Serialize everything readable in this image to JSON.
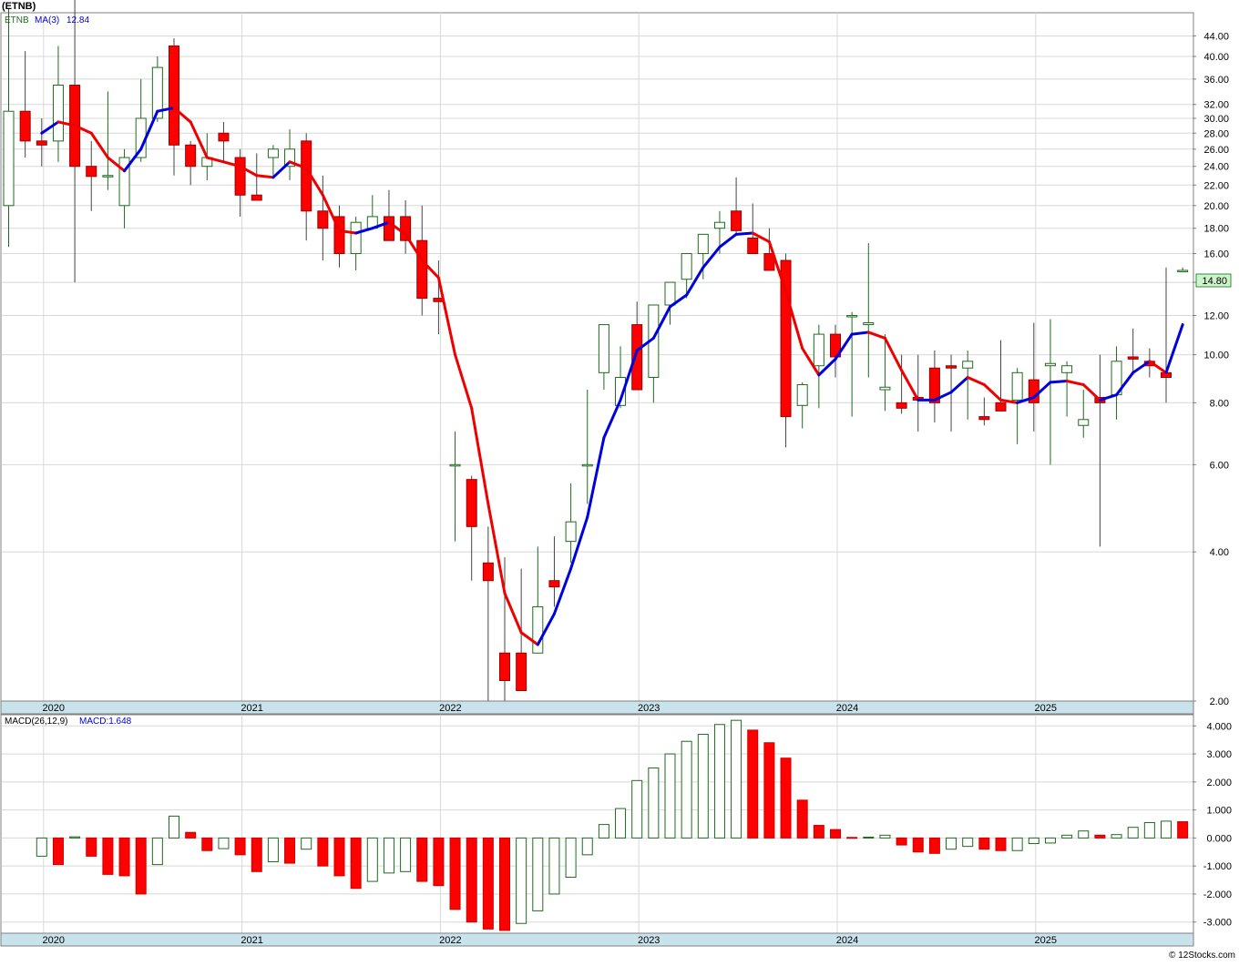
{
  "header": {
    "ticker_label": "(ETNB)"
  },
  "price_panel": {
    "legend_symbol": "ETNB",
    "ma_label": "MA(3)",
    "ma_value": "12.84",
    "last_price_label": "14.80",
    "y_ticks": [
      "2.00",
      "4.00",
      "6.00",
      "8.00",
      "10.00",
      "12.00",
      "14.00",
      "16.00",
      "18.00",
      "20.00",
      "22.00",
      "24.00",
      "26.00",
      "28.00",
      "30.00",
      "32.00",
      "36.00",
      "40.00",
      "44.00"
    ]
  },
  "macd_panel": {
    "legend_params": "MACD(26,12,9)",
    "legend_value": "MACD:1.648",
    "y_ticks": [
      "4.000",
      "3.000",
      "2.000",
      "1.000",
      "0.000",
      "-1.000",
      "-2.000",
      "-3.000"
    ]
  },
  "x_axis": {
    "year_labels": [
      "2020",
      "2021",
      "2022",
      "2023",
      "2024",
      "2025"
    ]
  },
  "footer": {
    "watermark": "© 12Stocks.com"
  },
  "colors": {
    "up": "#1e6b1e",
    "down": "#ff0000",
    "ma_up": "#0000dd",
    "ma_down": "#ee0000",
    "grid": "#d8d8d8",
    "axis_band": "#c9e3ec",
    "price_tag_bg": "#ccf5cc"
  },
  "chart_data": [
    {
      "type": "candlestick",
      "interval": "monthly",
      "scale": "log",
      "ylim": [
        2.0,
        49.0
      ],
      "months": [
        "2019-11",
        "2019-12",
        "2020-01",
        "2020-02",
        "2020-03",
        "2020-04",
        "2020-05",
        "2020-06",
        "2020-07",
        "2020-08",
        "2020-09",
        "2020-10",
        "2020-11",
        "2020-12",
        "2021-01",
        "2021-02",
        "2021-03",
        "2021-04",
        "2021-05",
        "2021-06",
        "2021-07",
        "2021-08",
        "2021-09",
        "2021-10",
        "2021-11",
        "2021-12",
        "2022-01",
        "2022-02",
        "2022-03",
        "2022-04",
        "2022-05",
        "2022-06",
        "2022-07",
        "2022-08",
        "2022-09",
        "2022-10",
        "2022-11",
        "2022-12",
        "2023-01",
        "2023-02",
        "2023-03",
        "2023-04",
        "2023-05",
        "2023-06",
        "2023-07",
        "2023-08",
        "2023-09",
        "2023-10",
        "2023-11",
        "2023-12",
        "2024-01",
        "2024-02",
        "2024-03",
        "2024-04",
        "2024-05",
        "2024-06",
        "2024-07",
        "2024-08",
        "2024-09",
        "2024-10",
        "2024-11",
        "2024-12",
        "2025-01",
        "2025-02",
        "2025-03",
        "2025-04",
        "2025-05",
        "2025-06",
        "2025-07",
        "2025-08",
        "2025-09",
        "2025-10"
      ],
      "open": [
        20.0,
        31.0,
        27.0,
        27.0,
        35.0,
        24.0,
        22.9,
        20.0,
        25.0,
        30.0,
        42.0,
        26.5,
        24.0,
        28.0,
        25.0,
        21.0,
        25.0,
        24.0,
        27.0,
        19.5,
        19.0,
        16.0,
        18.0,
        19.0,
        19.0,
        17.0,
        13.0,
        6.0,
        5.6,
        3.8,
        2.5,
        2.5,
        2.5,
        3.5,
        4.2,
        6.0,
        9.2,
        7.9,
        11.5,
        9.0,
        12.6,
        14.2,
        16.0,
        18.0,
        19.5,
        17.2,
        16.0,
        15.5,
        7.9,
        9.5,
        11.0,
        12.0,
        11.5,
        8.5,
        8.0,
        8.2,
        9.4,
        9.5,
        9.4,
        7.5,
        8.0,
        8.1,
        8.9,
        9.5,
        9.2,
        7.2,
        8.2,
        8.3,
        9.9,
        9.7,
        9.2,
        14.8
      ],
      "high": [
        50.0,
        41.0,
        30.0,
        42.0,
        52.0,
        27.0,
        34.0,
        26.0,
        36.0,
        40.0,
        43.5,
        27.0,
        28.0,
        29.5,
        26.0,
        25.5,
        26.5,
        28.5,
        28.0,
        23.0,
        20.0,
        19.0,
        21.0,
        21.5,
        20.5,
        20.0,
        15.5,
        7.0,
        5.7,
        4.5,
        3.9,
        3.7,
        4.1,
        4.3,
        5.5,
        8.5,
        10.8,
        10.4,
        12.8,
        11.0,
        13.6,
        15.3,
        17.5,
        19.5,
        22.8,
        20.2,
        18.0,
        16.0,
        8.8,
        11.5,
        11.5,
        12.2,
        16.8,
        11.0,
        10.0,
        10.0,
        10.2,
        10.0,
        10.2,
        8.2,
        10.7,
        9.4,
        11.6,
        11.8,
        9.7,
        8.5,
        10.0,
        10.4,
        11.3,
        10.3,
        15.0,
        15.0
      ],
      "low": [
        16.5,
        25.0,
        24.0,
        24.5,
        14.0,
        19.5,
        21.5,
        18.0,
        24.5,
        29.5,
        23.0,
        22.0,
        22.5,
        24.5,
        19.0,
        20.5,
        23.0,
        22.5,
        17.0,
        15.5,
        15.0,
        14.8,
        18.0,
        18.0,
        16.0,
        12.0,
        11.0,
        4.2,
        3.5,
        2.0,
        2.0,
        2.5,
        2.8,
        3.1,
        3.8,
        5.0,
        8.5,
        7.8,
        9.5,
        8.0,
        11.5,
        13.0,
        14.2,
        16.0,
        17.5,
        16.0,
        15.0,
        6.5,
        7.1,
        7.8,
        9.0,
        7.5,
        9.0,
        7.7,
        7.6,
        7.0,
        7.3,
        7.0,
        7.4,
        7.2,
        7.7,
        6.6,
        7.0,
        6.0,
        7.5,
        6.8,
        4.1,
        7.4,
        9.1,
        9.0,
        8.0,
        14.7
      ],
      "close": [
        31.0,
        27.0,
        26.5,
        35.0,
        24.0,
        22.9,
        23.0,
        25.0,
        30.0,
        38.0,
        26.5,
        24.0,
        25.0,
        27.0,
        21.0,
        20.5,
        26.0,
        26.0,
        19.5,
        18.0,
        16.0,
        18.5,
        19.0,
        17.0,
        17.0,
        13.0,
        12.8,
        6.0,
        4.5,
        3.5,
        2.2,
        2.1,
        3.1,
        3.4,
        4.6,
        6.0,
        11.5,
        9.0,
        8.5,
        12.6,
        14.0,
        16.0,
        17.5,
        18.5,
        17.8,
        16.0,
        14.8,
        7.5,
        8.7,
        11.0,
        9.9,
        12.0,
        11.6,
        8.6,
        7.8,
        8.1,
        8.0,
        9.4,
        9.7,
        7.4,
        7.7,
        9.2,
        8.0,
        9.6,
        9.5,
        7.4,
        8.0,
        9.7,
        9.8,
        9.5,
        9.0,
        14.8
      ]
    },
    {
      "type": "line",
      "name": "MA(3)",
      "x": [
        "2020-01",
        "2020-02",
        "2020-03",
        "2020-04",
        "2020-05",
        "2020-06",
        "2020-07",
        "2020-08",
        "2020-09",
        "2020-10",
        "2020-11",
        "2020-12",
        "2021-01",
        "2021-02",
        "2021-03",
        "2021-04",
        "2021-05",
        "2021-06",
        "2021-07",
        "2021-08",
        "2021-09",
        "2021-10",
        "2021-11",
        "2021-12",
        "2022-01",
        "2022-02",
        "2022-03",
        "2022-04",
        "2022-05",
        "2022-06",
        "2022-07",
        "2022-08",
        "2022-09",
        "2022-10",
        "2022-11",
        "2022-12",
        "2023-01",
        "2023-02",
        "2023-03",
        "2023-04",
        "2023-05",
        "2023-06",
        "2023-07",
        "2023-08",
        "2023-09",
        "2023-10",
        "2023-11",
        "2023-12",
        "2024-01",
        "2024-02",
        "2024-03",
        "2024-04",
        "2024-05",
        "2024-06",
        "2024-07",
        "2024-08",
        "2024-09",
        "2024-10",
        "2024-11",
        "2024-12",
        "2025-01",
        "2025-02",
        "2025-03",
        "2025-04",
        "2025-05",
        "2025-06",
        "2025-07",
        "2025-08",
        "2025-09",
        "2025-10"
      ],
      "y": [
        28.0,
        29.5,
        29.0,
        28.0,
        25.0,
        23.5,
        26.0,
        31.0,
        31.5,
        29.5,
        25.0,
        24.5,
        24.0,
        23.0,
        22.8,
        24.5,
        23.8,
        21.0,
        17.8,
        17.6,
        18.0,
        18.5,
        17.5,
        15.5,
        14.3,
        10.0,
        7.8,
        5.0,
        3.3,
        2.75,
        2.6,
        3.0,
        3.7,
        4.7,
        6.8,
        8.1,
        10.2,
        10.8,
        12.5,
        13.2,
        15.0,
        16.5,
        17.5,
        17.6,
        16.9,
        13.4,
        10.3,
        9.1,
        9.8,
        11.0,
        11.1,
        10.8,
        9.3,
        8.1,
        8.1,
        8.4,
        9.0,
        8.7,
        8.1,
        8.0,
        8.2,
        8.8,
        8.85,
        8.7,
        8.1,
        8.3,
        9.2,
        9.7,
        9.2,
        11.5,
        12.84
      ],
      "color_rule": "blue when rising, red when falling"
    },
    {
      "type": "bar",
      "name": "MACD(26,12,9)",
      "x": [
        "2020-01",
        "2020-02",
        "2020-03",
        "2020-04",
        "2020-05",
        "2020-06",
        "2020-07",
        "2020-08",
        "2020-09",
        "2020-10",
        "2020-11",
        "2020-12",
        "2021-01",
        "2021-02",
        "2021-03",
        "2021-04",
        "2021-05",
        "2021-06",
        "2021-07",
        "2021-08",
        "2021-09",
        "2021-10",
        "2021-11",
        "2021-12",
        "2022-01",
        "2022-02",
        "2022-03",
        "2022-04",
        "2022-05",
        "2022-06",
        "2022-07",
        "2022-08",
        "2022-09",
        "2022-10",
        "2022-11",
        "2022-12",
        "2023-01",
        "2023-02",
        "2023-03",
        "2023-04",
        "2023-05",
        "2023-06",
        "2023-07",
        "2023-08",
        "2023-09",
        "2023-10",
        "2023-11",
        "2023-12",
        "2024-01",
        "2024-02",
        "2024-03",
        "2024-04",
        "2024-05",
        "2024-06",
        "2024-07",
        "2024-08",
        "2024-09",
        "2024-10",
        "2024-11",
        "2024-12",
        "2025-01",
        "2025-02",
        "2025-03",
        "2025-04",
        "2025-05",
        "2025-06",
        "2025-07",
        "2025-08",
        "2025-09",
        "2025-10"
      ],
      "values": [
        -0.65,
        -0.95,
        0.04,
        -0.65,
        -1.3,
        -1.35,
        -2.0,
        -0.95,
        0.78,
        0.2,
        -0.45,
        -0.38,
        -0.6,
        -1.2,
        -0.85,
        -0.9,
        -0.4,
        -1.0,
        -1.35,
        -1.8,
        -1.55,
        -1.25,
        -1.2,
        -1.55,
        -1.7,
        -2.55,
        -3.0,
        -3.25,
        -3.3,
        -3.05,
        -2.6,
        -2.0,
        -1.4,
        -0.6,
        0.48,
        1.05,
        2.05,
        2.5,
        3.0,
        3.45,
        3.7,
        4.05,
        4.2,
        3.85,
        3.4,
        2.85,
        1.35,
        0.45,
        0.3,
        0.02,
        0.03,
        0.1,
        -0.25,
        -0.5,
        -0.55,
        -0.4,
        -0.3,
        -0.4,
        -0.45,
        -0.45,
        -0.2,
        -0.18,
        0.1,
        0.25,
        0.1,
        0.12,
        0.38,
        0.55,
        0.6,
        0.58,
        1.25,
        1.648
      ],
      "color_rule": "green outline when rising, red fill when falling",
      "ylim": [
        -3.4,
        4.4
      ],
      "ticks": [
        4.0,
        3.0,
        2.0,
        1.0,
        0.0,
        -1.0,
        -2.0,
        -3.0
      ]
    }
  ]
}
